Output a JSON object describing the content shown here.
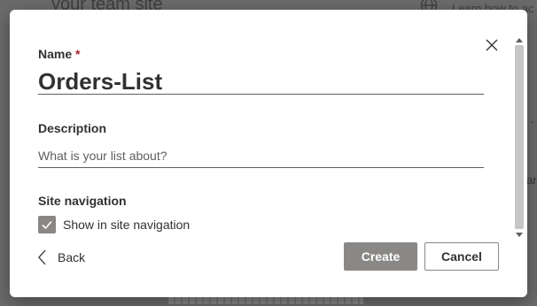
{
  "background": {
    "site_title": "your team site",
    "help_link": "Learn how to ac",
    "fragment_ar": "ar",
    "fragment_dot": "·"
  },
  "dialog": {
    "name": {
      "label": "Name",
      "required_marker": "*",
      "value": "Orders-List"
    },
    "description": {
      "label": "Description",
      "placeholder": "What is your list about?"
    },
    "site_navigation": {
      "label": "Site navigation",
      "checkbox_label": "Show in site navigation",
      "checked": true
    },
    "back_label": "Back",
    "create_label": "Create",
    "cancel_label": "Cancel"
  },
  "colors": {
    "primary_button_disabled": "#8a8886",
    "required_star": "#a4262c",
    "text": "#323130"
  },
  "icons": {
    "close": "close-icon",
    "back": "chevron-left-icon",
    "check": "checkmark-icon",
    "globe": "globe-icon"
  }
}
